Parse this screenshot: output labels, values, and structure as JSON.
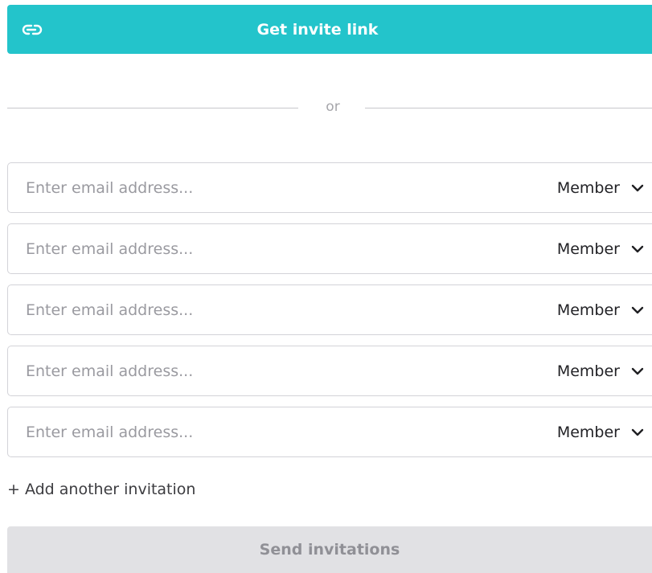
{
  "invite_link": {
    "label": "Get invite link",
    "icon": "link-icon",
    "color": "#23c4cb"
  },
  "divider": {
    "text": "or"
  },
  "invitations": [
    {
      "placeholder": "Enter email address...",
      "role": "Member"
    },
    {
      "placeholder": "Enter email address...",
      "role": "Member"
    },
    {
      "placeholder": "Enter email address...",
      "role": "Member"
    },
    {
      "placeholder": "Enter email address...",
      "role": "Member"
    },
    {
      "placeholder": "Enter email address...",
      "role": "Member"
    }
  ],
  "add_another": {
    "label": "+ Add another invitation"
  },
  "send": {
    "label": "Send invitations",
    "disabled": true
  }
}
